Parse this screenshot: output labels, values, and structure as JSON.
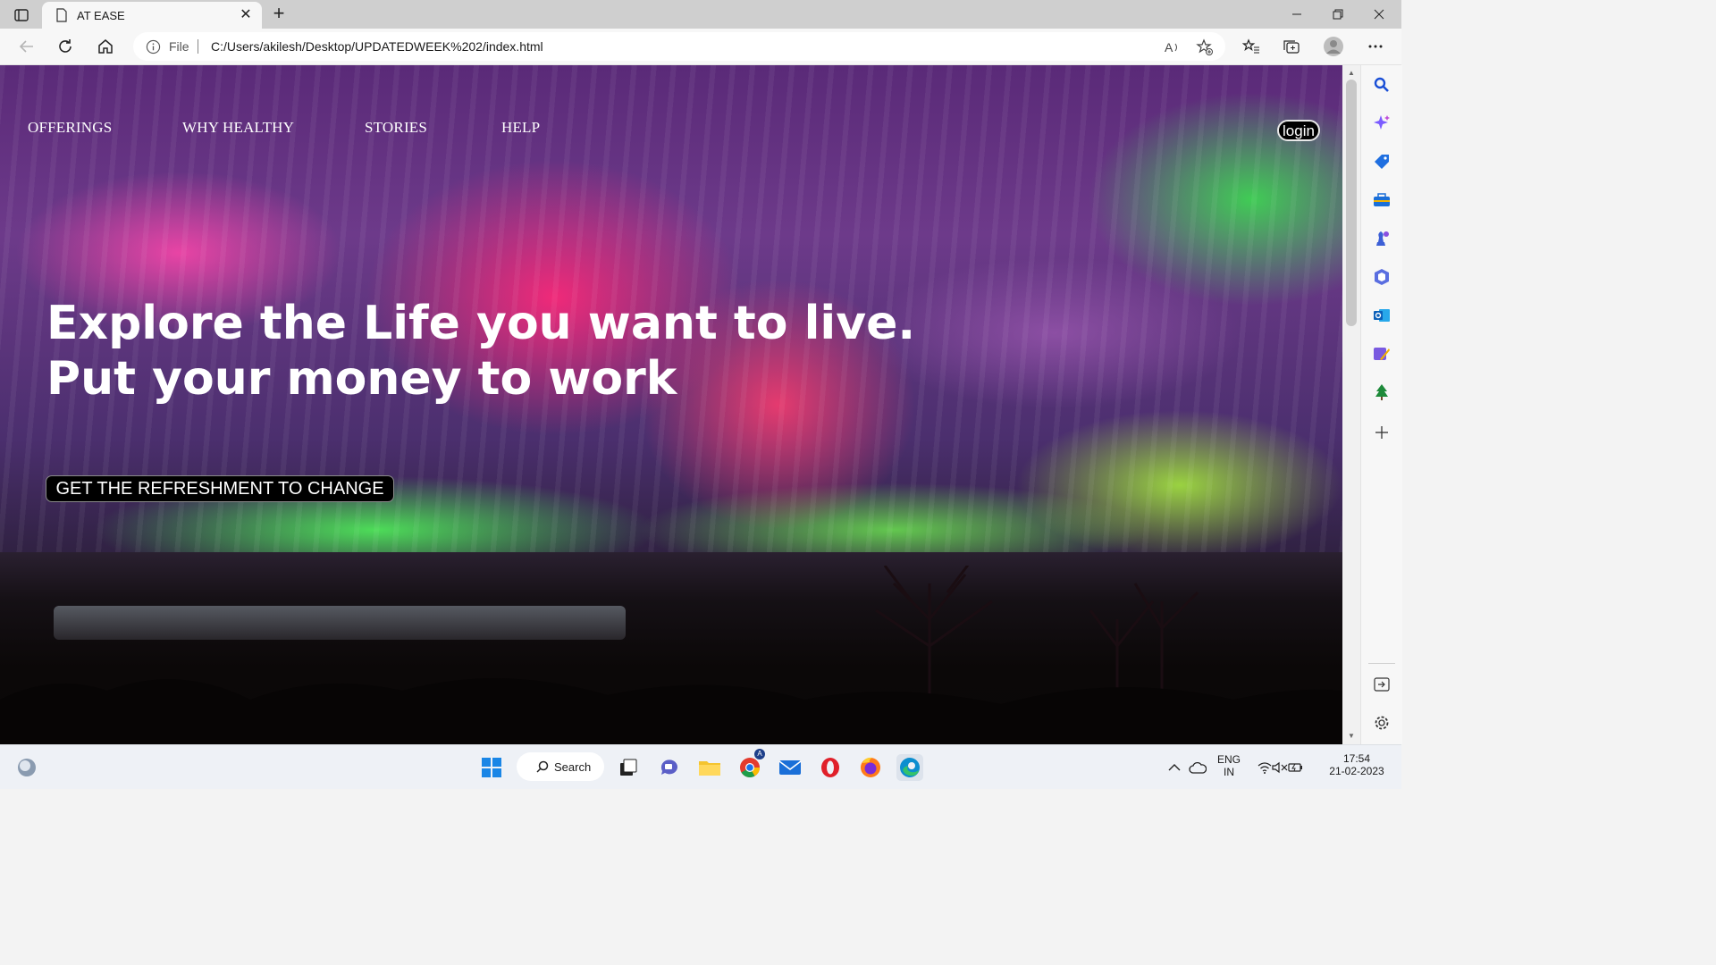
{
  "browser": {
    "tab": {
      "title": "AT EASE"
    },
    "address": {
      "scheme_label": "File",
      "url": "C:/Users/akilesh/Desktop/UPDATEDWEEK%202/index.html"
    }
  },
  "page": {
    "nav": [
      "OFFERINGS",
      "WHY HEALTHY",
      "STORIES",
      "HELP"
    ],
    "login_label": "login",
    "hero_line1": "Explore the Life you want to live.",
    "hero_line2": "Put your money to work",
    "cta_label": "GET THE REFRESHMENT TO CHANGE"
  },
  "taskbar": {
    "search_label": "Search",
    "chrome_badge": "A",
    "language": "ENG",
    "region": "IN",
    "time": "17:54",
    "date": "21-02-2023"
  },
  "colors": {
    "accent_edge": "#0067c0",
    "copilot": "#7b5cff"
  }
}
